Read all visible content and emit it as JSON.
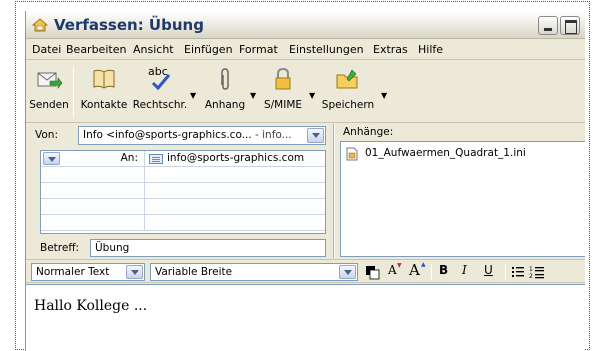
{
  "window": {
    "title": "Verfassen: Übung"
  },
  "menu": [
    {
      "label": "Datei"
    },
    {
      "label": "Bearbeiten"
    },
    {
      "label": "Ansicht"
    },
    {
      "label": "Einfügen"
    },
    {
      "label": "Format"
    },
    {
      "label": "Einstellungen"
    },
    {
      "label": "Extras"
    },
    {
      "label": "Hilfe"
    }
  ],
  "toolbar": {
    "send": "Senden",
    "contacts": "Kontakte",
    "spell": "Rechtschr.",
    "attach": "Anhang",
    "smime": "S/MIME",
    "save": "Speichern",
    "spell_icon_text": "abc"
  },
  "header": {
    "from_label": "Von:",
    "from_value": "Info <info@sports-graphics.co...",
    "from_account": "- info...",
    "recipient_type": "An:",
    "recipient_address": "info@sports-graphics.com",
    "subject_label": "Betreff:",
    "subject_value": "Übung",
    "attachments_label": "Anhänge:",
    "attachment_file": "01_Aufwaermen_Quadrat_1.ini"
  },
  "format": {
    "paragraph_style": "Normaler Text",
    "font": "Variable Breite",
    "smaller": "A",
    "larger": "A",
    "bold": "B",
    "italic": "I",
    "underline": "U"
  },
  "body": {
    "text": "Hallo Kollege ..."
  },
  "colors": {
    "window_bg": "#ece9d8",
    "title_text": "#1f3a6a",
    "input_border": "#7f9db9"
  }
}
